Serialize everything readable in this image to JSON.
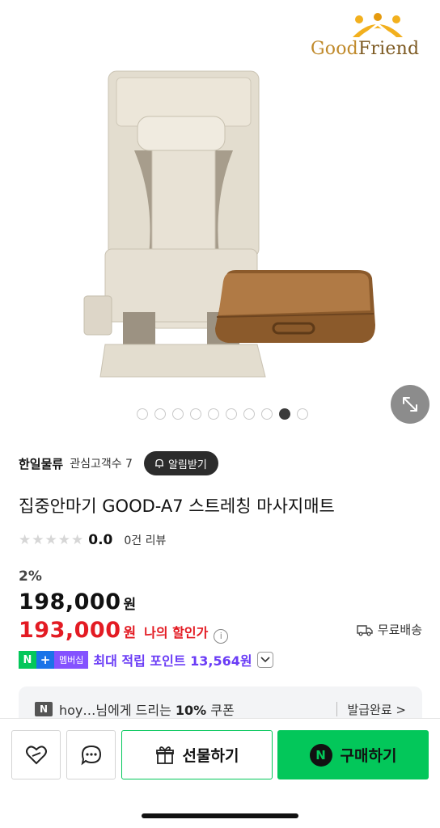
{
  "brand_logo": {
    "text_part1": "Good",
    "text_part2": "Friend",
    "color": "#c08a2b"
  },
  "gallery": {
    "total_images": 10,
    "active_index": 8
  },
  "seller": {
    "name": "한일물류",
    "followers": "관심고객수 7",
    "alarm_button": "알림받기"
  },
  "product": {
    "title": "집중안마기 GOOD-A7 스트레칭 마사지매트",
    "rating_score": "0.0",
    "review_count": "0건 리뷰",
    "discount_rate": "2%",
    "original_price": "198,000",
    "original_unit": "원",
    "sale_price": "193,000",
    "sale_unit": "원",
    "my_discount_label": "나의 할인가",
    "shipping": "무료배송"
  },
  "points": {
    "badge_n": "N",
    "badge_plus": "+",
    "badge_member": "멤버십",
    "text": "최대 적립 포인트 13,564원"
  },
  "coupon": {
    "icon": "N",
    "text_prefix": "hoy…님에게 드리는 ",
    "text_bold": "10%",
    "text_suffix": " 쿠폰",
    "status": "발급완료 >"
  },
  "bottom_bar": {
    "gift_label": "선물하기",
    "buy_label": "구매하기",
    "buy_badge": "N"
  },
  "colors": {
    "naver_green": "#03c75a",
    "sale_red": "#e31b23",
    "points_purple": "#6a3cf6"
  }
}
